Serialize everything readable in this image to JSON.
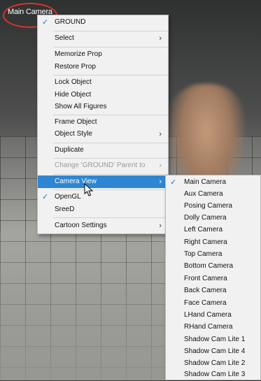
{
  "viewport": {
    "camera_name": "Main Camera"
  },
  "context_menu": {
    "items": [
      {
        "label": "GROUND",
        "checked": true
      },
      {
        "label": "Select",
        "submenu": true
      },
      {
        "label": "Memorize Prop"
      },
      {
        "label": "Restore Prop"
      },
      {
        "label": "Lock Object"
      },
      {
        "label": "Hide Object"
      },
      {
        "label": "Show All Figures"
      },
      {
        "label": "Frame Object"
      },
      {
        "label": "Object Style",
        "submenu": true
      },
      {
        "label": "Duplicate"
      },
      {
        "label": "Change 'GROUND' Parent to",
        "submenu": true,
        "disabled": true
      },
      {
        "label": "Camera View",
        "submenu": true,
        "highlighted": true
      },
      {
        "label": "OpenGL",
        "checked": true
      },
      {
        "label": "SreeD"
      },
      {
        "label": "Cartoon Settings",
        "submenu": true
      }
    ]
  },
  "camera_submenu": {
    "items": [
      {
        "label": "Main Camera",
        "checked": true
      },
      {
        "label": "Aux Camera"
      },
      {
        "label": "Posing Camera"
      },
      {
        "label": "Dolly Camera"
      },
      {
        "label": "Left Camera"
      },
      {
        "label": "Right Camera"
      },
      {
        "label": "Top Camera"
      },
      {
        "label": "Bottom Camera"
      },
      {
        "label": "Front Camera"
      },
      {
        "label": "Back Camera"
      },
      {
        "label": "Face Camera"
      },
      {
        "label": "LHand Camera"
      },
      {
        "label": "RHand Camera"
      },
      {
        "label": "Shadow Cam Lite 1"
      },
      {
        "label": "Shadow Cam Lite 4"
      },
      {
        "label": "Shadow Cam Lite 2"
      },
      {
        "label": "Shadow Cam Lite 3"
      }
    ]
  },
  "glyphs": {
    "check": "✓",
    "arrow": "›"
  },
  "colors": {
    "highlight": "#2e86d3",
    "check": "#1f72c9",
    "annotation_circle": "#d9342b"
  }
}
